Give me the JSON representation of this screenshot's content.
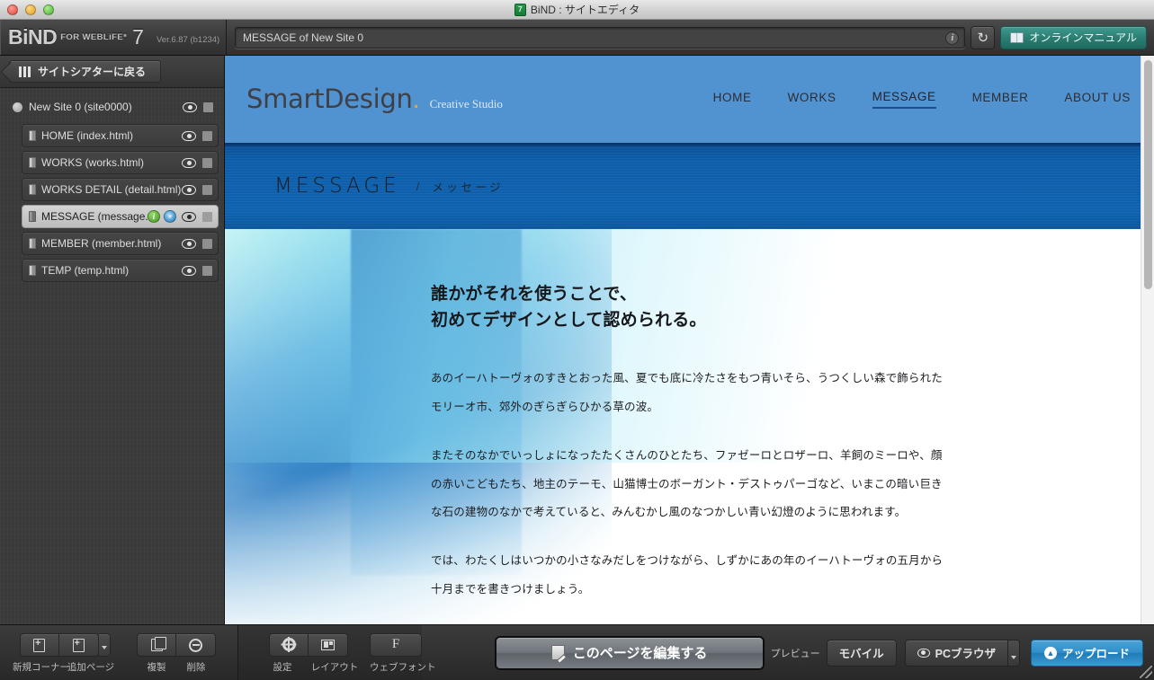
{
  "window": {
    "title": "BiND : サイトエディタ",
    "app_icon": "7"
  },
  "toolbar": {
    "brand_name": "BiND",
    "brand_tagline": "FOR WEBLiFE*",
    "brand_version_number": "7",
    "version_text": "Ver.6.87 (b1234)",
    "address_value": "MESSAGE of New Site 0",
    "info_label": "i",
    "reload_label": "↻",
    "manual_label": "オンラインマニュアル"
  },
  "sidebar": {
    "theater_button": "サイトシアターに戻る",
    "site": {
      "label": "New Site 0 (site0000)"
    },
    "pages": [
      {
        "label": "HOME (index.html)",
        "selected": false,
        "badges": []
      },
      {
        "label": "WORKS (works.html)",
        "selected": false,
        "badges": []
      },
      {
        "label": "WORKS DETAIL (detail.html)",
        "selected": false,
        "badges": []
      },
      {
        "label": "MESSAGE (message.h...",
        "selected": true,
        "badges": [
          "info",
          "settings"
        ]
      },
      {
        "label": "MEMBER (member.html)",
        "selected": false,
        "badges": []
      },
      {
        "label": "TEMP (temp.html)",
        "selected": false,
        "badges": []
      }
    ]
  },
  "preview": {
    "site": {
      "logo": "SmartDesign",
      "logo_dot": ".",
      "logo_sub": "Creative Studio",
      "nav": [
        {
          "label": "HOME",
          "active": false
        },
        {
          "label": "WORKS",
          "active": false
        },
        {
          "label": "MESSAGE",
          "active": true
        },
        {
          "label": "MEMBER",
          "active": false
        },
        {
          "label": "ABOUT US",
          "active": false
        }
      ],
      "banner_en": "MESSAGE",
      "banner_slash": "/",
      "banner_jp": "メッセージ",
      "headline_line1": "誰かがそれを使うことで、",
      "headline_line2": "初めてデザインとして認められる。",
      "paragraphs": [
        "あのイーハトーヴォのすきとおった風、夏でも底に冷たさをもつ青いそら、うつくしい森で飾られたモリーオ市、郊外のぎらぎらひかる草の波。",
        "またそのなかでいっしょになったたくさんのひとたち、ファゼーロとロザーロ、羊飼のミーロや、顔の赤いこどもたち、地主のテーモ、山猫博士のボーガント・デストゥパーゴなど、いまこの暗い巨きな石の建物のなかで考えていると、みんむかし風のなつかしい青い幻燈のように思われます。",
        "では、わたくしはいつかの小さなみだしをつけながら、しずかにあの年のイーハトーヴォの五月から十月までを書きつけましょう。"
      ]
    }
  },
  "bottombar": {
    "new_corner_label": "新規コーナー",
    "add_page_label": "追加ページ",
    "duplicate_label": "複製",
    "delete_label": "削除",
    "settings_label": "設定",
    "layout_label": "レイアウト",
    "webfont_label": "ウェブフォント",
    "edit_page_label": "このページを編集する",
    "preview_label": "プレビュー",
    "mobile_label": "モバイル",
    "pc_browser_label": "PCブラウザ",
    "upload_label": "アップロード"
  },
  "colors": {
    "accent_blue": "#5193d1",
    "banner_blue": "#0d5ea9",
    "orange_rule": "#e8a53c",
    "upload_blue": "#2f8ec9",
    "manual_teal": "#2c7f74"
  }
}
